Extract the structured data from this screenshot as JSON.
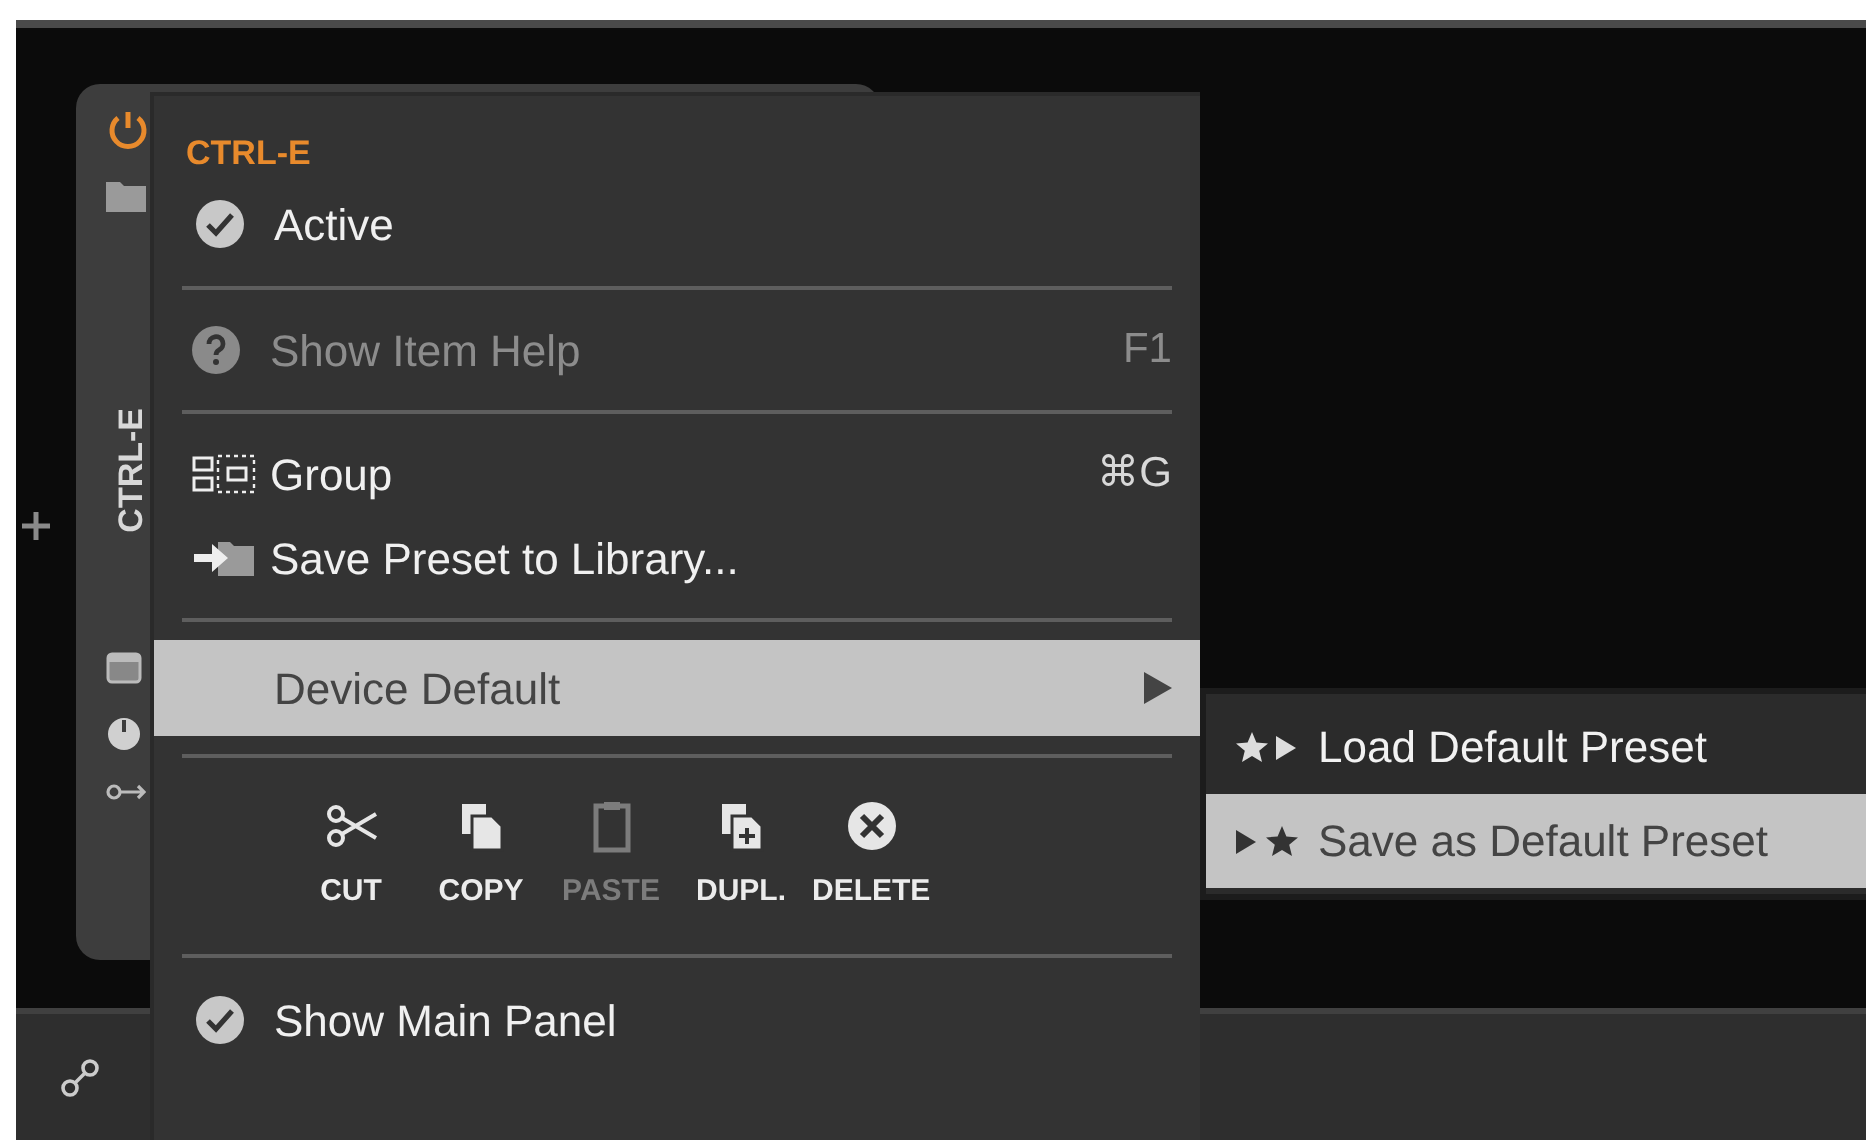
{
  "device": {
    "name": "CTRL-E"
  },
  "menu": {
    "header": "CTRL-E",
    "items": [
      {
        "kind": "check",
        "label": "Active",
        "checked": true
      },
      {
        "kind": "separator"
      },
      {
        "kind": "action",
        "label": "Show Item Help",
        "shortcut": "F1",
        "disabled": true
      },
      {
        "kind": "separator"
      },
      {
        "kind": "action",
        "label": "Group",
        "shortcut": "⌘G",
        "disabled": false
      },
      {
        "kind": "action",
        "label": "Save Preset to Library...",
        "disabled": false
      },
      {
        "kind": "separator"
      },
      {
        "kind": "submenu",
        "label": "Device Default",
        "selected": true
      },
      {
        "kind": "separator"
      },
      {
        "kind": "actions",
        "actions": [
          {
            "label": "CUT",
            "disabled": false
          },
          {
            "label": "COPY",
            "disabled": false
          },
          {
            "label": "PASTE",
            "disabled": true
          },
          {
            "label": "DUPL.",
            "disabled": false
          },
          {
            "label": "DELETE",
            "disabled": false
          }
        ]
      },
      {
        "kind": "separator"
      },
      {
        "kind": "check",
        "label": "Show Main Panel",
        "checked": true
      }
    ]
  },
  "submenu": {
    "items": [
      {
        "label": "Load Default Preset",
        "selected": false
      },
      {
        "label": "Save as Default Preset",
        "selected": true
      }
    ]
  }
}
